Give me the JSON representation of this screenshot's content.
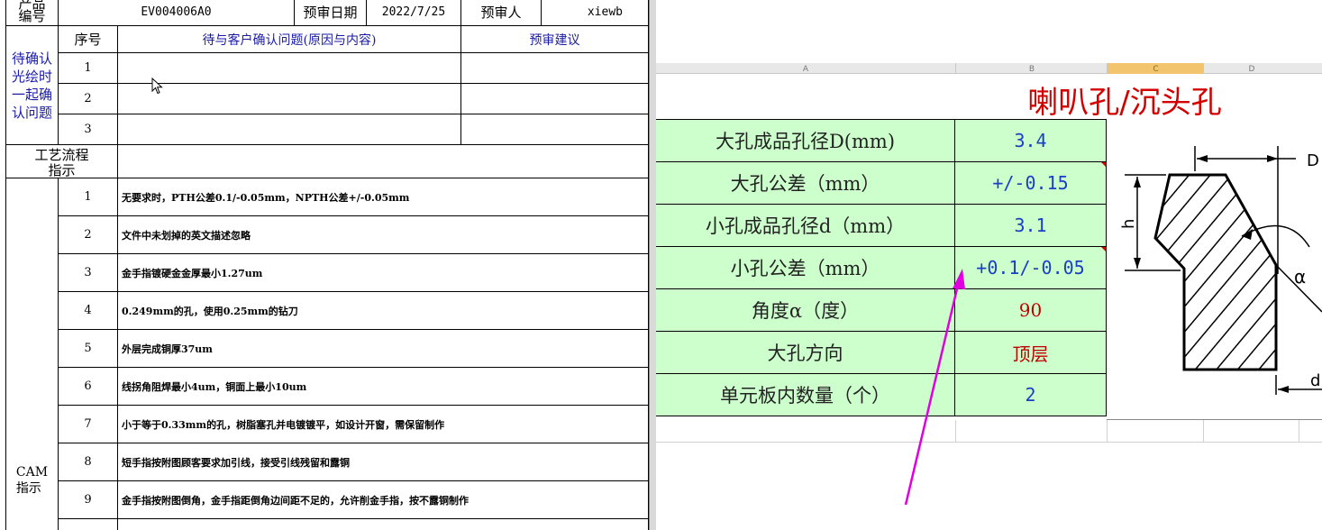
{
  "left_sheet": {
    "header": {
      "product_label": "产品\n编号",
      "product_code": "EV004006A0",
      "review_date_label": "预审日期",
      "review_date": "2022/7/25",
      "reviewer_label": "预审人",
      "reviewer": "xiewb"
    },
    "confirm_section": {
      "side_label": "待确认\n光绘时\n一起确\n认问题",
      "col_seq": "序号",
      "col_issue": "待与客户确认问题(原因与内容)",
      "col_suggest": "预审建议",
      "rows": [
        "1",
        "2",
        "3"
      ]
    },
    "process_label": "工艺流程\n指示",
    "cam_section": {
      "side_label": "CAM\n指示",
      "items": [
        {
          "seq": "1",
          "text": "无要求时，PTH公差0.1/-0.05mm，NPTH公差+/-0.05mm"
        },
        {
          "seq": "2",
          "text": "文件中未划掉的英文描述忽略"
        },
        {
          "seq": "3",
          "text": "金手指镀硬金金厚最小1.27um"
        },
        {
          "seq": "4",
          "text": "0.249mm的孔，使用0.25mm的钻刀"
        },
        {
          "seq": "5",
          "text": "外层完成铜厚37um"
        },
        {
          "seq": "6",
          "text": "线拐角阻焊最小4um，铜面上最小10um"
        },
        {
          "seq": "7",
          "text": "小于等于0.33mm的孔，树脂塞孔并电镀镀平，如设计开窗，需保留制作"
        },
        {
          "seq": "8",
          "text": "短手指按附图顾客要求加引线，接受引线残留和露铜"
        },
        {
          "seq": "9",
          "text": "金手指按附图倒角，金手指距倒角边间距不足的，允许削金手指，按不露铜制作"
        }
      ]
    }
  },
  "right_sheet": {
    "column_headers": [
      "A",
      "B",
      "C",
      "D"
    ],
    "title": "喇叭孔/沉头孔",
    "rows": [
      {
        "label": "大孔成品孔径D(mm)",
        "value": "3.4",
        "color": "blue"
      },
      {
        "label": "大孔公差（mm）",
        "value": "+/-0.15",
        "color": "blue"
      },
      {
        "label": "小孔成品孔径d（mm）",
        "value": "3.1",
        "color": "blue"
      },
      {
        "label": "小孔公差（mm）",
        "value": "+0.1/-0.05",
        "color": "blue"
      },
      {
        "label": "角度α（度）",
        "value": "90",
        "color": "red"
      },
      {
        "label": "大孔方向",
        "value": "顶层",
        "color": "red"
      },
      {
        "label": "单元板内数量（个）",
        "value": "2",
        "color": "blue"
      }
    ],
    "diagram_labels": {
      "D": "D",
      "h": "h",
      "a": "α",
      "d": "d"
    }
  },
  "colors": {
    "label_bg": "#ccffcc",
    "title_red": "#d40000",
    "value_blue": "#1a3fc7",
    "value_red": "#c00000",
    "annotation_arrow": "#e000e0"
  }
}
